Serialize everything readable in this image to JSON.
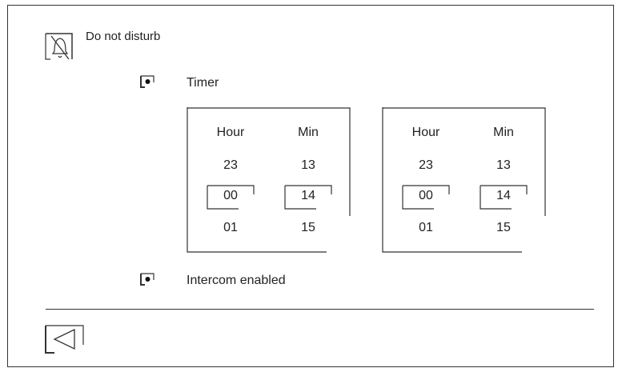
{
  "header": {
    "mode_label": "Do not disturb",
    "mode_icon": "bell-off-icon"
  },
  "options": [
    {
      "label": "Timer",
      "selected": true
    },
    {
      "label": "Intercom enabled",
      "selected": true
    }
  ],
  "pickers": [
    {
      "hour_header": "Hour",
      "min_header": "Min",
      "hours": [
        "23",
        "00",
        "01"
      ],
      "mins": [
        "13",
        "14",
        "15"
      ],
      "selected_hour": "00",
      "selected_min": "14"
    },
    {
      "hour_header": "Hour",
      "min_header": "Min",
      "hours": [
        "23",
        "00",
        "01"
      ],
      "mins": [
        "13",
        "14",
        "15"
      ],
      "selected_hour": "00",
      "selected_min": "14"
    }
  ],
  "footer": {
    "back_icon": "back-arrow-icon"
  }
}
